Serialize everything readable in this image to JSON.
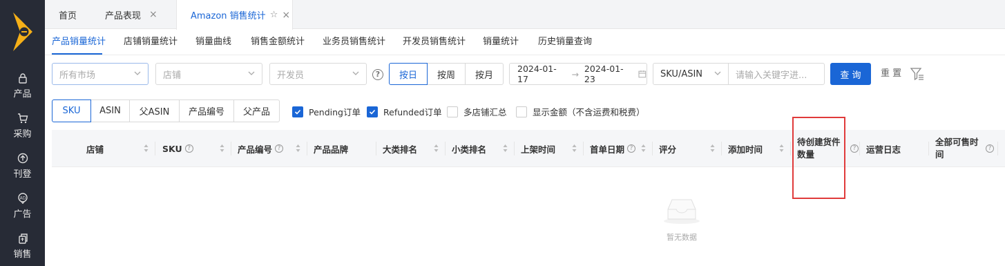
{
  "sidebar": {
    "items": [
      {
        "label": "产品",
        "icon": "lock-icon"
      },
      {
        "label": "采购",
        "icon": "cart-icon"
      },
      {
        "label": "刊登",
        "icon": "upload-circle-icon"
      },
      {
        "label": "广告",
        "icon": "ad-icon"
      },
      {
        "label": "销售",
        "icon": "sales-icon"
      }
    ]
  },
  "tabs": [
    {
      "label": "首页"
    },
    {
      "label": "产品表现"
    },
    {
      "label": "Amazon 销售统计"
    }
  ],
  "subnav": [
    {
      "label": "产品销量统计"
    },
    {
      "label": "店铺销量统计"
    },
    {
      "label": "销量曲线"
    },
    {
      "label": "销售金额统计"
    },
    {
      "label": "业务员销售统计"
    },
    {
      "label": "开发员销售统计"
    },
    {
      "label": "销量统计"
    },
    {
      "label": "历史销量查询"
    }
  ],
  "filters": {
    "market_placeholder": "所有市场",
    "shop_placeholder": "店铺",
    "developer_placeholder": "开发员",
    "period": [
      "按日",
      "按周",
      "按月"
    ],
    "date_start": "2024-01-17",
    "date_end": "2024-01-23",
    "search_type": "SKU/ASIN",
    "search_placeholder": "请输入关键字进...",
    "query_label": "查 询",
    "reset_label": "重 置"
  },
  "dimension_tabs": [
    "SKU",
    "ASIN",
    "父ASIN",
    "产品编号",
    "父产品"
  ],
  "checkboxes": [
    {
      "label": "Pending订单",
      "checked": true
    },
    {
      "label": "Refunded订单",
      "checked": true
    },
    {
      "label": "多店铺汇总",
      "checked": false
    },
    {
      "label": "显示金额（不含运费和税费）",
      "checked": false
    }
  ],
  "table": {
    "columns": [
      {
        "label": "店铺"
      },
      {
        "label": "SKU"
      },
      {
        "label": "产品编号"
      },
      {
        "label": "产品品牌"
      },
      {
        "label": "大类排名"
      },
      {
        "label": "小类排名"
      },
      {
        "label": "上架时间"
      },
      {
        "label": "首单日期"
      },
      {
        "label": "评分"
      },
      {
        "label": "添加时间"
      },
      {
        "label_line1": "待创建货件",
        "label_line2": "数量"
      },
      {
        "label": "运营日志"
      },
      {
        "label_line1": "全部可售时",
        "label_line2": "间"
      }
    ],
    "empty_text": "暂无数据"
  },
  "colors": {
    "primary": "#1a66d6",
    "sidebar_bg": "#272b36",
    "highlight": "#e03a3a",
    "logo": "#f6b018"
  }
}
